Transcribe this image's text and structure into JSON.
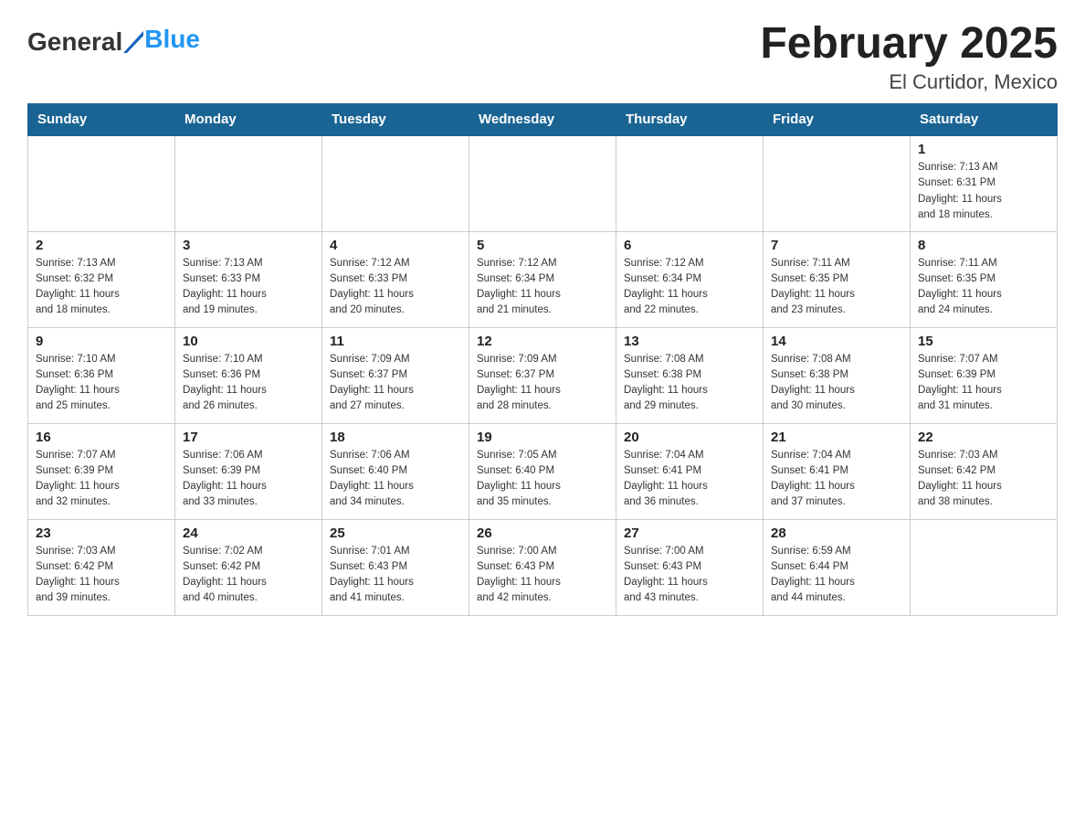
{
  "logo": {
    "text_general": "General",
    "text_blue": "Blue"
  },
  "header": {
    "title": "February 2025",
    "subtitle": "El Curtidor, Mexico"
  },
  "weekdays": [
    "Sunday",
    "Monday",
    "Tuesday",
    "Wednesday",
    "Thursday",
    "Friday",
    "Saturday"
  ],
  "weeks": [
    [
      {
        "day": "",
        "info": ""
      },
      {
        "day": "",
        "info": ""
      },
      {
        "day": "",
        "info": ""
      },
      {
        "day": "",
        "info": ""
      },
      {
        "day": "",
        "info": ""
      },
      {
        "day": "",
        "info": ""
      },
      {
        "day": "1",
        "info": "Sunrise: 7:13 AM\nSunset: 6:31 PM\nDaylight: 11 hours\nand 18 minutes."
      }
    ],
    [
      {
        "day": "2",
        "info": "Sunrise: 7:13 AM\nSunset: 6:32 PM\nDaylight: 11 hours\nand 18 minutes."
      },
      {
        "day": "3",
        "info": "Sunrise: 7:13 AM\nSunset: 6:33 PM\nDaylight: 11 hours\nand 19 minutes."
      },
      {
        "day": "4",
        "info": "Sunrise: 7:12 AM\nSunset: 6:33 PM\nDaylight: 11 hours\nand 20 minutes."
      },
      {
        "day": "5",
        "info": "Sunrise: 7:12 AM\nSunset: 6:34 PM\nDaylight: 11 hours\nand 21 minutes."
      },
      {
        "day": "6",
        "info": "Sunrise: 7:12 AM\nSunset: 6:34 PM\nDaylight: 11 hours\nand 22 minutes."
      },
      {
        "day": "7",
        "info": "Sunrise: 7:11 AM\nSunset: 6:35 PM\nDaylight: 11 hours\nand 23 minutes."
      },
      {
        "day": "8",
        "info": "Sunrise: 7:11 AM\nSunset: 6:35 PM\nDaylight: 11 hours\nand 24 minutes."
      }
    ],
    [
      {
        "day": "9",
        "info": "Sunrise: 7:10 AM\nSunset: 6:36 PM\nDaylight: 11 hours\nand 25 minutes."
      },
      {
        "day": "10",
        "info": "Sunrise: 7:10 AM\nSunset: 6:36 PM\nDaylight: 11 hours\nand 26 minutes."
      },
      {
        "day": "11",
        "info": "Sunrise: 7:09 AM\nSunset: 6:37 PM\nDaylight: 11 hours\nand 27 minutes."
      },
      {
        "day": "12",
        "info": "Sunrise: 7:09 AM\nSunset: 6:37 PM\nDaylight: 11 hours\nand 28 minutes."
      },
      {
        "day": "13",
        "info": "Sunrise: 7:08 AM\nSunset: 6:38 PM\nDaylight: 11 hours\nand 29 minutes."
      },
      {
        "day": "14",
        "info": "Sunrise: 7:08 AM\nSunset: 6:38 PM\nDaylight: 11 hours\nand 30 minutes."
      },
      {
        "day": "15",
        "info": "Sunrise: 7:07 AM\nSunset: 6:39 PM\nDaylight: 11 hours\nand 31 minutes."
      }
    ],
    [
      {
        "day": "16",
        "info": "Sunrise: 7:07 AM\nSunset: 6:39 PM\nDaylight: 11 hours\nand 32 minutes."
      },
      {
        "day": "17",
        "info": "Sunrise: 7:06 AM\nSunset: 6:39 PM\nDaylight: 11 hours\nand 33 minutes."
      },
      {
        "day": "18",
        "info": "Sunrise: 7:06 AM\nSunset: 6:40 PM\nDaylight: 11 hours\nand 34 minutes."
      },
      {
        "day": "19",
        "info": "Sunrise: 7:05 AM\nSunset: 6:40 PM\nDaylight: 11 hours\nand 35 minutes."
      },
      {
        "day": "20",
        "info": "Sunrise: 7:04 AM\nSunset: 6:41 PM\nDaylight: 11 hours\nand 36 minutes."
      },
      {
        "day": "21",
        "info": "Sunrise: 7:04 AM\nSunset: 6:41 PM\nDaylight: 11 hours\nand 37 minutes."
      },
      {
        "day": "22",
        "info": "Sunrise: 7:03 AM\nSunset: 6:42 PM\nDaylight: 11 hours\nand 38 minutes."
      }
    ],
    [
      {
        "day": "23",
        "info": "Sunrise: 7:03 AM\nSunset: 6:42 PM\nDaylight: 11 hours\nand 39 minutes."
      },
      {
        "day": "24",
        "info": "Sunrise: 7:02 AM\nSunset: 6:42 PM\nDaylight: 11 hours\nand 40 minutes."
      },
      {
        "day": "25",
        "info": "Sunrise: 7:01 AM\nSunset: 6:43 PM\nDaylight: 11 hours\nand 41 minutes."
      },
      {
        "day": "26",
        "info": "Sunrise: 7:00 AM\nSunset: 6:43 PM\nDaylight: 11 hours\nand 42 minutes."
      },
      {
        "day": "27",
        "info": "Sunrise: 7:00 AM\nSunset: 6:43 PM\nDaylight: 11 hours\nand 43 minutes."
      },
      {
        "day": "28",
        "info": "Sunrise: 6:59 AM\nSunset: 6:44 PM\nDaylight: 11 hours\nand 44 minutes."
      },
      {
        "day": "",
        "info": ""
      }
    ]
  ]
}
